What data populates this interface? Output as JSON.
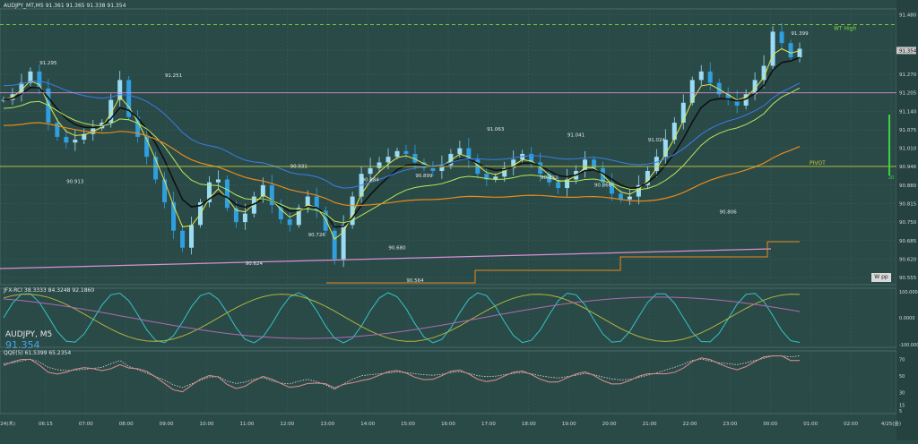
{
  "window": {
    "symbol_label": "AUDJPY, M5",
    "bid_big": "91.354",
    "header": "AUDJPY_MT,M5  91.361 91.365 91.338 91.354",
    "oscillator_header": "JFX-RCI 38.3333 84.3248 92.1860",
    "qqe_header": "QQE(5) 61.5399 65.2354"
  },
  "colors": {
    "background": "#2a4a48",
    "grid": "#3e5f5c",
    "bull": "#9adcf5",
    "bear": "#2f9fdf",
    "pivot": "#c9c93a",
    "pink": "#d98fd4",
    "orange": "#e88a1a",
    "high_dash": "#7cdc3a",
    "ma_black": "#111111",
    "ma_yellow": "#e6e64a",
    "ma_lime": "#b9e65a",
    "ma_blue": "#3a7ee8",
    "rci_cyan": "#35c2c8",
    "rci_olive": "#b3b33a",
    "rci_purple": "#b06ab0",
    "qqe_line": "#d08a8a",
    "qqe_dot": "#e0e0e0"
  },
  "chart_data": [
    {
      "type": "candlestick",
      "timeframe": "M5",
      "title": "AUDJPY_MT,M5  91.361 91.365 91.338 91.354",
      "ylim": [
        90.53,
        91.5
      ],
      "y_ticks": [
        "91.480",
        "91.354",
        "91.270",
        "91.205",
        "91.140",
        "91.075",
        "91.010",
        "90.946",
        "90.880",
        "90.815",
        "90.750",
        "90.685",
        "90.620",
        "90.555"
      ],
      "x_labels": [
        "4/24(木)",
        "06:15",
        "07:00",
        "08:00",
        "09:00",
        "10:00",
        "11:00",
        "12:00",
        "13:00",
        "14:00",
        "15:00",
        "16:00",
        "17:00",
        "18:00",
        "19:00",
        "20:00",
        "21:00",
        "22:00",
        "23:00",
        "00:00",
        "01:00",
        "02:00",
        "4/25(金)"
      ],
      "close_path": [
        [
          0,
          91.18
        ],
        [
          1,
          91.2
        ],
        [
          2,
          91.24
        ],
        [
          3,
          91.28
        ],
        [
          4,
          91.22
        ],
        [
          5,
          91.1
        ],
        [
          6,
          91.05
        ],
        [
          7,
          91.03
        ],
        [
          8,
          91.04
        ],
        [
          9,
          91.06
        ],
        [
          10,
          91.08
        ],
        [
          11,
          91.1
        ],
        [
          12,
          91.18
        ],
        [
          13,
          91.25
        ],
        [
          14,
          91.12
        ],
        [
          15,
          91.05
        ],
        [
          16,
          90.98
        ],
        [
          17,
          90.9
        ],
        [
          18,
          90.82
        ],
        [
          19,
          90.72
        ],
        [
          20,
          90.66
        ],
        [
          21,
          90.74
        ],
        [
          22,
          90.82
        ],
        [
          23,
          90.89
        ],
        [
          24,
          90.9
        ],
        [
          25,
          90.8
        ],
        [
          26,
          90.75
        ],
        [
          27,
          90.78
        ],
        [
          28,
          90.84
        ],
        [
          29,
          90.88
        ],
        [
          30,
          90.81
        ],
        [
          31,
          90.76
        ],
        [
          32,
          90.74
        ],
        [
          33,
          90.8
        ],
        [
          34,
          90.84
        ],
        [
          35,
          90.79
        ],
        [
          36,
          90.72
        ],
        [
          37,
          90.62
        ],
        [
          38,
          90.74
        ],
        [
          39,
          90.84
        ],
        [
          40,
          90.92
        ],
        [
          41,
          90.94
        ],
        [
          42,
          90.96
        ],
        [
          43,
          90.98
        ],
        [
          44,
          91.0
        ],
        [
          45,
          90.99
        ],
        [
          46,
          90.96
        ],
        [
          47,
          90.94
        ],
        [
          48,
          90.93
        ],
        [
          49,
          90.95
        ],
        [
          50,
          90.99
        ],
        [
          51,
          91.01
        ],
        [
          52,
          90.97
        ],
        [
          53,
          90.92
        ],
        [
          54,
          90.9
        ],
        [
          55,
          90.91
        ],
        [
          56,
          90.94
        ],
        [
          57,
          90.97
        ],
        [
          58,
          90.99
        ],
        [
          59,
          90.96
        ],
        [
          60,
          90.92
        ],
        [
          61,
          90.89
        ],
        [
          62,
          90.87
        ],
        [
          63,
          90.9
        ],
        [
          64,
          90.93
        ],
        [
          65,
          90.97
        ],
        [
          66,
          90.94
        ],
        [
          67,
          90.89
        ],
        [
          68,
          90.85
        ],
        [
          69,
          90.83
        ],
        [
          70,
          90.84
        ],
        [
          71,
          90.88
        ],
        [
          72,
          90.93
        ],
        [
          73,
          90.98
        ],
        [
          74,
          91.04
        ],
        [
          75,
          91.1
        ],
        [
          76,
          91.17
        ],
        [
          77,
          91.25
        ],
        [
          78,
          91.28
        ],
        [
          79,
          91.24
        ],
        [
          80,
          91.2
        ],
        [
          81,
          91.18
        ],
        [
          82,
          91.16
        ],
        [
          83,
          91.2
        ],
        [
          84,
          91.25
        ],
        [
          85,
          91.3
        ],
        [
          86,
          91.42
        ],
        [
          87,
          91.38
        ],
        [
          88,
          91.33
        ],
        [
          89,
          91.36
        ]
      ],
      "price_labels": [
        {
          "text": "91.295",
          "i": 5,
          "v": 91.295,
          "pos": "above"
        },
        {
          "text": "91.251",
          "i": 19,
          "v": 91.251,
          "pos": "above"
        },
        {
          "text": "91.063",
          "i": 55,
          "v": 91.063,
          "pos": "above"
        },
        {
          "text": "91.041",
          "i": 64,
          "v": 91.041,
          "pos": "above"
        },
        {
          "text": "91.024",
          "i": 73,
          "v": 91.024,
          "pos": "above"
        },
        {
          "text": "90.931",
          "i": 33,
          "v": 90.931,
          "pos": "above"
        },
        {
          "text": "90.884",
          "i": 41,
          "v": 90.884,
          "pos": "above"
        },
        {
          "text": "90.899",
          "i": 47,
          "v": 90.899,
          "pos": "above"
        },
        {
          "text": "90.892",
          "i": 61,
          "v": 90.892,
          "pos": "above"
        },
        {
          "text": "90.866",
          "i": 67,
          "v": 90.866,
          "pos": "above"
        },
        {
          "text": "91.399",
          "i": 98,
          "v": 91.399,
          "pos": "above"
        },
        {
          "text": "90.913",
          "i": 8,
          "v": 90.913,
          "pos": "below"
        },
        {
          "text": "90.726",
          "i": 35,
          "v": 90.726,
          "pos": "below"
        },
        {
          "text": "90.680",
          "i": 44,
          "v": 90.68,
          "pos": "below"
        },
        {
          "text": "90.624",
          "i": 28,
          "v": 90.624,
          "pos": "below"
        },
        {
          "text": "90.564",
          "i": 46,
          "v": 90.564,
          "pos": "below"
        },
        {
          "text": "90.806",
          "i": 81,
          "v": 90.806,
          "pos": "below"
        }
      ],
      "levels": [
        {
          "name": "WT High",
          "value": 91.445,
          "style": "dashed",
          "color": "#7cdc3a"
        },
        {
          "name": "PIVOT",
          "value": 90.946,
          "style": "solid",
          "color": "#c9c93a"
        },
        {
          "name": "pink-level",
          "value": 91.205,
          "style": "solid",
          "color": "#d98fd4"
        }
      ],
      "annotation_labels": [
        "WT High",
        "PIVOT",
        "W pp",
        "20"
      ]
    },
    {
      "type": "line",
      "name": "JFX-RCI",
      "title": "JFX-RCI 38.3333 84.3248 92.1860",
      "ylim": [
        -100,
        100
      ],
      "values_header": [
        38.3333,
        84.3248,
        92.186
      ],
      "y_ticks": [
        "100.0000",
        "0.0000",
        "-100.0000"
      ]
    },
    {
      "type": "line",
      "name": "QQE",
      "title": "QQE(5) 61.5399 65.2354",
      "ylim": [
        5,
        80
      ],
      "values_header": [
        61.5399,
        65.2354
      ],
      "y_ticks": [
        "70",
        "50",
        "30",
        "15",
        "5"
      ]
    }
  ]
}
